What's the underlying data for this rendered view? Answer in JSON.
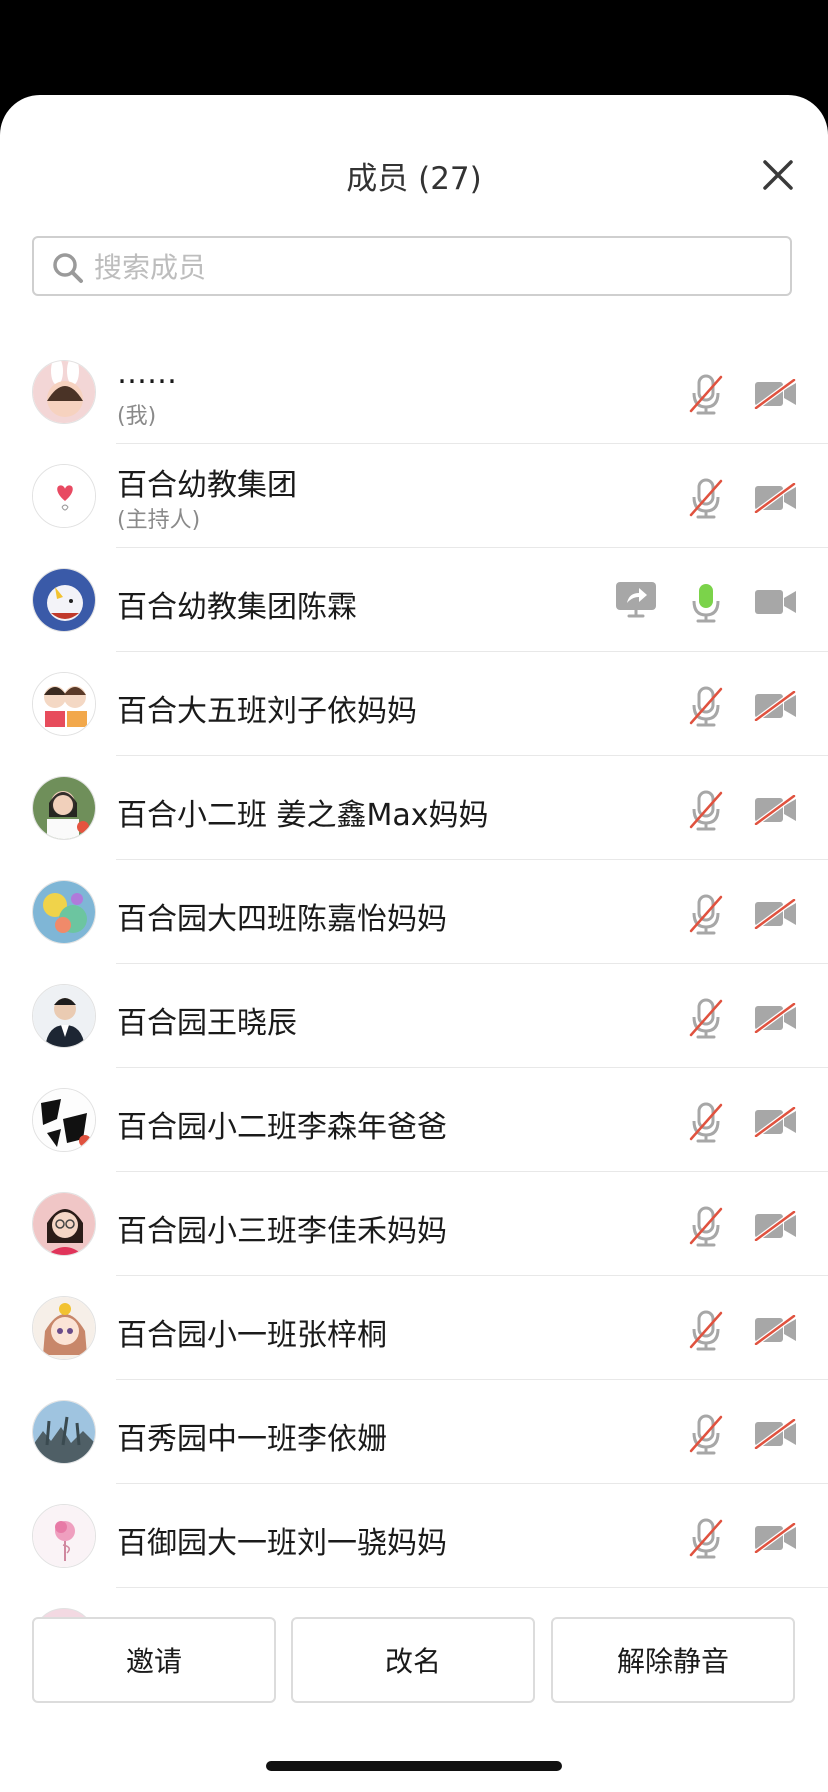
{
  "header": {
    "title": "成员 (27)"
  },
  "search": {
    "placeholder": "搜索成员",
    "value": ""
  },
  "members": [
    {
      "name": "……",
      "sub": "(我)",
      "mic": "muted",
      "cam": "off",
      "avatar": "child-bunny-ears"
    },
    {
      "name": "百合幼教集团",
      "sub": "(主持人)",
      "mic": "muted",
      "cam": "off",
      "avatar": "heart-logo"
    },
    {
      "name": "百合幼教集团陈霖",
      "sub": "",
      "mic": "active",
      "cam": "on",
      "sharing": true,
      "avatar": "unicorn"
    },
    {
      "name": "百合大五班刘子依妈妈",
      "sub": "",
      "mic": "muted",
      "cam": "off",
      "avatar": "cartoon-couple"
    },
    {
      "name": "百合小二班 姜之鑫Max妈妈",
      "sub": "",
      "mic": "muted",
      "cam": "off",
      "avatar": "woman-photo"
    },
    {
      "name": "百合园大四班陈嘉怡妈妈",
      "sub": "",
      "mic": "muted",
      "cam": "off",
      "avatar": "colorful-art"
    },
    {
      "name": "百合园王晓辰",
      "sub": "",
      "mic": "muted",
      "cam": "off",
      "avatar": "man-suit"
    },
    {
      "name": "百合园小二班李森年爸爸",
      "sub": "",
      "mic": "muted",
      "cam": "off",
      "avatar": "calligraphy"
    },
    {
      "name": "百合园小三班李佳禾妈妈",
      "sub": "",
      "mic": "muted",
      "cam": "off",
      "avatar": "woman-glasses"
    },
    {
      "name": "百合园小一班张梓桐",
      "sub": "",
      "mic": "muted",
      "cam": "off",
      "avatar": "anime-girl"
    },
    {
      "name": "百秀园中一班李依姗",
      "sub": "",
      "mic": "muted",
      "cam": "off",
      "avatar": "landscape"
    },
    {
      "name": "百御园大一班刘一骁妈妈",
      "sub": "",
      "mic": "muted",
      "cam": "off",
      "avatar": "flamingo"
    }
  ],
  "footer": {
    "invite": "邀请",
    "rename": "改名",
    "unmute": "解除静音"
  },
  "colors": {
    "mic_active": "#7bd34a",
    "muted_slash": "#e0523f",
    "icon_gray": "#a7a7a7"
  }
}
